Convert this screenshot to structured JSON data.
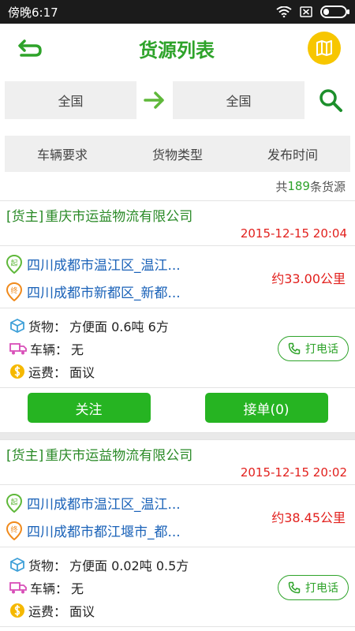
{
  "statusbar": {
    "time": "傍晚6:17"
  },
  "header": {
    "title": "货源列表"
  },
  "route": {
    "from": "全国",
    "to": "全国"
  },
  "filters": [
    {
      "label": "车辆要求"
    },
    {
      "label": "货物类型"
    },
    {
      "label": "发布时间"
    }
  ],
  "total": {
    "prefix": "共",
    "count": "189",
    "suffix": "条货源"
  },
  "cards": [
    {
      "tag": "[货主]",
      "company": "重庆市运益物流有限公司",
      "date": "2015-12-15 20:04",
      "origin": "四川成都市温江区_温江...",
      "destination": "四川成都市新都区_新都...",
      "distance": "约33.00公里",
      "goods_label": "货物：",
      "goods": "方便面  0.6吨  6方",
      "vehicle_label": "车辆：",
      "vehicle": "无",
      "freight_label": "运费：",
      "freight": "面议",
      "call_label": "打电话",
      "follow_label": "关注",
      "accept_label": "接单(0)",
      "origin_badge": "起",
      "destination_badge": "终"
    },
    {
      "tag": "[货主]",
      "company": "重庆市运益物流有限公司",
      "date": "2015-12-15 20:02",
      "origin": "四川成都市温江区_温江...",
      "destination": "四川成都市都江堰市_都...",
      "distance": "约38.45公里",
      "goods_label": "货物：",
      "goods": "方便面  0.02吨  0.5方",
      "vehicle_label": "车辆：",
      "vehicle": "无",
      "freight_label": "运费：",
      "freight": "面议",
      "call_label": "打电话",
      "origin_badge": "起",
      "destination_badge": "终"
    }
  ],
  "icons": {
    "back": "back-arrow-icon",
    "map": "map-icon",
    "route_arrow": "arrow-right-icon",
    "search": "search-icon",
    "origin_pin": "origin-pin-icon",
    "destination_pin": "destination-pin-icon",
    "goods": "box-icon",
    "vehicle": "truck-icon",
    "freight": "coin-icon",
    "phone": "phone-icon"
  },
  "colors": {
    "accent": "#2ea32a",
    "button": "#26b422",
    "date_red": "#e2201d",
    "map_yellow": "#f7c600",
    "link_blue": "#1a62b8"
  }
}
